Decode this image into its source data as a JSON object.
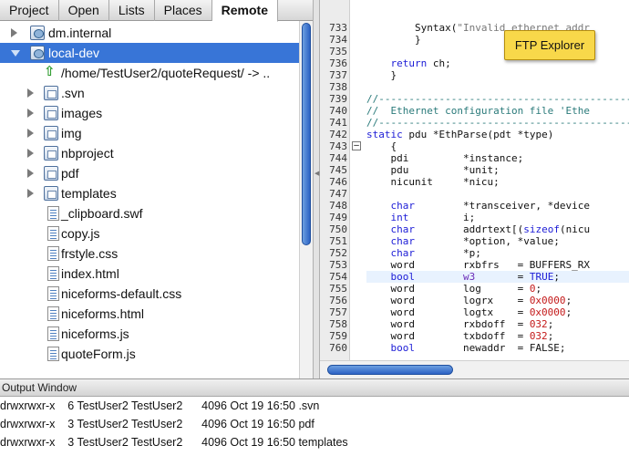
{
  "tabs": [
    {
      "label": "Project",
      "active": false
    },
    {
      "label": "Open",
      "active": false
    },
    {
      "label": "Lists",
      "active": false
    },
    {
      "label": "Places",
      "active": false
    },
    {
      "label": "Remote",
      "active": true
    }
  ],
  "tree": [
    {
      "label": "dm.internal",
      "icon": "site",
      "disclosure": "collapsed",
      "depth": 0,
      "selected": false
    },
    {
      "label": "local-dev",
      "icon": "site",
      "disclosure": "expanded",
      "depth": 0,
      "selected": true
    },
    {
      "label": "/home/TestUser2/quoteRequest/ -> ..",
      "icon": "up-arrow",
      "disclosure": "none",
      "depth": 1,
      "selected": false
    },
    {
      "label": ".svn",
      "icon": "folder",
      "disclosure": "collapsed",
      "depth": 1,
      "selected": false
    },
    {
      "label": "images",
      "icon": "folder",
      "disclosure": "collapsed",
      "depth": 1,
      "selected": false
    },
    {
      "label": "img",
      "icon": "folder",
      "disclosure": "collapsed",
      "depth": 1,
      "selected": false
    },
    {
      "label": "nbproject",
      "icon": "folder",
      "disclosure": "collapsed",
      "depth": 1,
      "selected": false
    },
    {
      "label": "pdf",
      "icon": "folder",
      "disclosure": "collapsed",
      "depth": 1,
      "selected": false
    },
    {
      "label": "templates",
      "icon": "folder",
      "disclosure": "collapsed",
      "depth": 1,
      "selected": false
    },
    {
      "label": "_clipboard.swf",
      "icon": "file",
      "disclosure": "none",
      "depth": 1,
      "selected": false
    },
    {
      "label": "copy.js",
      "icon": "file",
      "disclosure": "none",
      "depth": 1,
      "selected": false
    },
    {
      "label": "frstyle.css",
      "icon": "file",
      "disclosure": "none",
      "depth": 1,
      "selected": false
    },
    {
      "label": "index.html",
      "icon": "file",
      "disclosure": "none",
      "depth": 1,
      "selected": false
    },
    {
      "label": "niceforms-default.css",
      "icon": "file",
      "disclosure": "none",
      "depth": 1,
      "selected": false
    },
    {
      "label": "niceforms.html",
      "icon": "file",
      "disclosure": "none",
      "depth": 1,
      "selected": false
    },
    {
      "label": "niceforms.js",
      "icon": "file",
      "disclosure": "none",
      "depth": 1,
      "selected": false
    },
    {
      "label": "quoteForm.js",
      "icon": "file",
      "disclosure": "none",
      "depth": 1,
      "selected": false
    }
  ],
  "editor": {
    "current_line": "754",
    "fold_line": "743",
    "lines": [
      {
        "n": "733",
        "t": [
          [
            "n",
            "        Syntax("
          ],
          [
            "s",
            "\"Invalid ethernet addr"
          ]
        ]
      },
      {
        "n": "734",
        "t": [
          [
            "n",
            "        }"
          ]
        ]
      },
      {
        "n": "735",
        "t": [
          [
            "n",
            ""
          ]
        ]
      },
      {
        "n": "736",
        "t": [
          [
            "n",
            "    "
          ],
          [
            "k",
            "return"
          ],
          [
            "n",
            " ch;"
          ]
        ]
      },
      {
        "n": "737",
        "t": [
          [
            "n",
            "    }"
          ]
        ]
      },
      {
        "n": "738",
        "t": [
          [
            "n",
            ""
          ]
        ]
      },
      {
        "n": "739",
        "t": [
          [
            "c",
            "//------------------------------------------"
          ]
        ]
      },
      {
        "n": "740",
        "t": [
          [
            "c",
            "//  Ethernet configuration file 'Ethe"
          ]
        ]
      },
      {
        "n": "741",
        "t": [
          [
            "c",
            "//------------------------------------------"
          ]
        ]
      },
      {
        "n": "742",
        "t": [
          [
            "k",
            "static"
          ],
          [
            "n",
            " pdu *EthParse(pdt *type)"
          ]
        ]
      },
      {
        "n": "743",
        "t": [
          [
            "n",
            "    {"
          ]
        ]
      },
      {
        "n": "744",
        "t": [
          [
            "n",
            "    pdi         *instance;"
          ]
        ]
      },
      {
        "n": "745",
        "t": [
          [
            "n",
            "    pdu         *unit;"
          ]
        ]
      },
      {
        "n": "746",
        "t": [
          [
            "n",
            "    nicunit     *nicu;"
          ]
        ]
      },
      {
        "n": "747",
        "t": [
          [
            "n",
            ""
          ]
        ]
      },
      {
        "n": "748",
        "t": [
          [
            "k",
            "    char"
          ],
          [
            "n",
            "        *transceiver, *device"
          ]
        ]
      },
      {
        "n": "749",
        "t": [
          [
            "k",
            "    int"
          ],
          [
            "n",
            "         i;"
          ]
        ]
      },
      {
        "n": "750",
        "t": [
          [
            "k",
            "    char"
          ],
          [
            "n",
            "        addrtext[("
          ],
          [
            "k",
            "sizeof"
          ],
          [
            "n",
            "(nicu"
          ]
        ]
      },
      {
        "n": "751",
        "t": [
          [
            "k",
            "    char"
          ],
          [
            "n",
            "        *option, *value;"
          ]
        ]
      },
      {
        "n": "752",
        "t": [
          [
            "k",
            "    char"
          ],
          [
            "n",
            "        *p;"
          ]
        ]
      },
      {
        "n": "753",
        "t": [
          [
            "n",
            "    word        rxbfrs   = BUFFERS_RX"
          ]
        ]
      },
      {
        "n": "754",
        "t": [
          [
            "k",
            "    bool"
          ],
          [
            "n",
            "        "
          ],
          [
            "v",
            "w3"
          ],
          [
            "n",
            "       = "
          ],
          [
            "k",
            "TRUE"
          ],
          [
            "n",
            ";"
          ]
        ]
      },
      {
        "n": "755",
        "t": [
          [
            "n",
            "    word        log      = "
          ],
          [
            "r",
            "0"
          ],
          [
            "n",
            ";"
          ]
        ]
      },
      {
        "n": "756",
        "t": [
          [
            "n",
            "    word        logrx    = "
          ],
          [
            "r",
            "0x0000"
          ],
          [
            "n",
            ";"
          ]
        ]
      },
      {
        "n": "757",
        "t": [
          [
            "n",
            "    word        logtx    = "
          ],
          [
            "r",
            "0x0000"
          ],
          [
            "n",
            ";"
          ]
        ]
      },
      {
        "n": "758",
        "t": [
          [
            "n",
            "    word        rxbdoff  = "
          ],
          [
            "r",
            "032"
          ],
          [
            "n",
            ";"
          ]
        ]
      },
      {
        "n": "759",
        "t": [
          [
            "n",
            "    word        txbdoff  = "
          ],
          [
            "r",
            "032"
          ],
          [
            "n",
            ";"
          ]
        ]
      },
      {
        "n": "760",
        "t": [
          [
            "k",
            "    bool"
          ],
          [
            "n",
            "        newaddr  = FALSE;"
          ]
        ]
      }
    ]
  },
  "tooltip": {
    "text": "FTP Explorer"
  },
  "output": {
    "title": "Output Window",
    "lines": [
      "drwxrwxr-x    6 TestUser2 TestUser2      4096 Oct 19 16:50 .svn",
      "drwxrwxr-x    3 TestUser2 TestUser2      4096 Oct 19 16:50 pdf",
      "drwxrwxr-x    3 TestUser2 TestUser2      4096 Oct 19 16:50 templates"
    ]
  },
  "colors": {
    "selection": "#3875d7",
    "keyword": "#1c1cd6",
    "comment": "#2a7a7a",
    "number": "#c41a1a",
    "tooltip": "#f8d84a"
  }
}
